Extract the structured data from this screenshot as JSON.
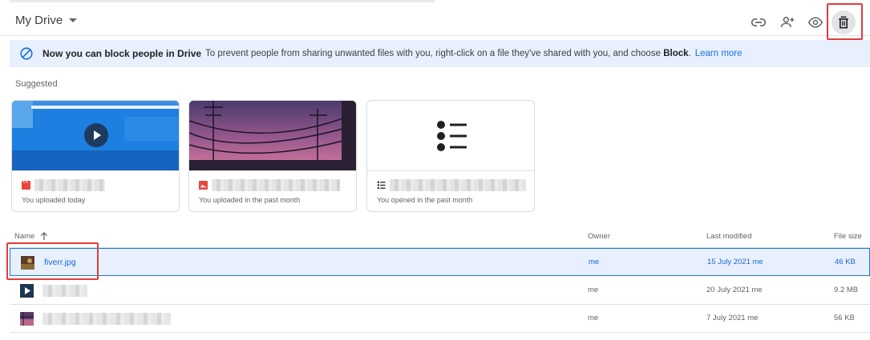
{
  "header": {
    "title": "My Drive",
    "actions": [
      {
        "name": "get-link",
        "icon": "link-icon"
      },
      {
        "name": "share",
        "icon": "person-add-icon"
      },
      {
        "name": "preview",
        "icon": "eye-icon"
      },
      {
        "name": "remove",
        "icon": "trash-icon",
        "active": true
      }
    ]
  },
  "banner": {
    "icon": "block-icon",
    "title": "Now you can block people in Drive",
    "body": "To prevent people from sharing unwanted files with you, right-click on a file they've shared with you, and choose",
    "bold": "Block",
    "suffix": ".",
    "link": "Learn more"
  },
  "suggested": {
    "label": "Suggested",
    "cards": [
      {
        "thumb": "video",
        "icon": "video-file-icon",
        "subtitle": "You uploaded today"
      },
      {
        "thumb": "image",
        "icon": "image-file-icon",
        "subtitle": "You uploaded in the past month"
      },
      {
        "thumb": "list",
        "icon": "list-file-icon",
        "subtitle": "You opened in the past month"
      }
    ]
  },
  "table": {
    "columns": {
      "name": "Name",
      "owner": "Owner",
      "modified": "Last modified",
      "size": "File size"
    },
    "rows": [
      {
        "name": "fiverr.jpg",
        "owner": "me",
        "modified": "15 July 2021",
        "modified_by": "me",
        "size": "46 KB",
        "selected": true,
        "icon": "image-thumbnail-icon"
      },
      {
        "name": "",
        "owner": "me",
        "modified": "20 July 2021",
        "modified_by": "me",
        "size": "9.2 MB",
        "selected": false,
        "icon": "video-thumbnail-icon"
      },
      {
        "name": "",
        "owner": "me",
        "modified": "7 July 2021",
        "modified_by": "me",
        "size": "56 KB",
        "selected": false,
        "icon": "image-thumbnail-icon"
      }
    ]
  },
  "colors": {
    "accent": "#1a73e8",
    "selection": "#e8f0fe",
    "annotation": "#e33b3b"
  }
}
